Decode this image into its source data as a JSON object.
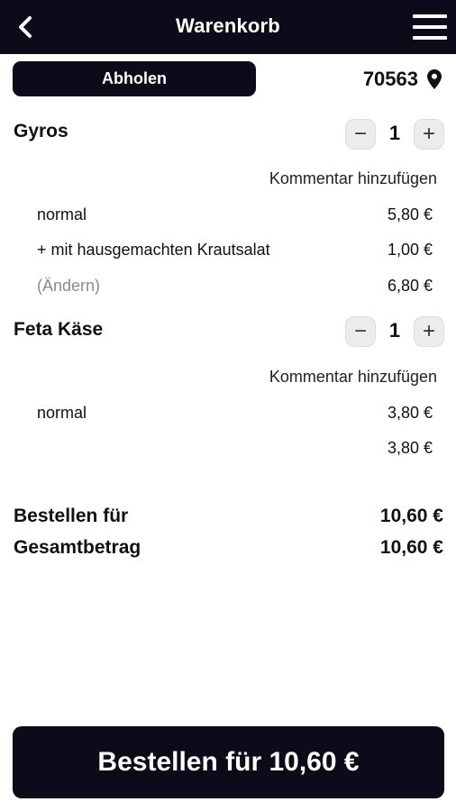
{
  "header": {
    "title": "Warenkorb",
    "back_icon": "chevron-left-icon",
    "menu_icon": "hamburger-menu-icon"
  },
  "pickup": {
    "label": "Abholen",
    "postal_code": "70563",
    "location_icon": "map-pin-icon"
  },
  "items": [
    {
      "name": "Gyros",
      "quantity": "1",
      "comment_label": "Kommentar hinzufügen",
      "lines": [
        {
          "label": "normal",
          "price": "5,80 €"
        },
        {
          "label": "+ mit hausgemachten Krautsalat",
          "price": "1,00 €"
        },
        {
          "label": "(Ändern)",
          "price": "6,80 €"
        }
      ]
    },
    {
      "name": "Feta Käse",
      "quantity": "1",
      "comment_label": "Kommentar hinzufügen",
      "lines": [
        {
          "label": "normal",
          "price": "3,80 €"
        },
        {
          "label": "",
          "price": "3,80 €"
        }
      ]
    }
  ],
  "summary": {
    "order_for_label": "Bestellen für",
    "order_for_value": "10,60 €",
    "total_label": "Gesamtbetrag",
    "total_value": "10,60 €"
  },
  "order_button": {
    "label": "Bestellen für 10,60 €"
  },
  "colors": {
    "primary": "#0b0b1a",
    "muted_text": "#8a8a8a",
    "stepper_bg": "#ececec"
  }
}
